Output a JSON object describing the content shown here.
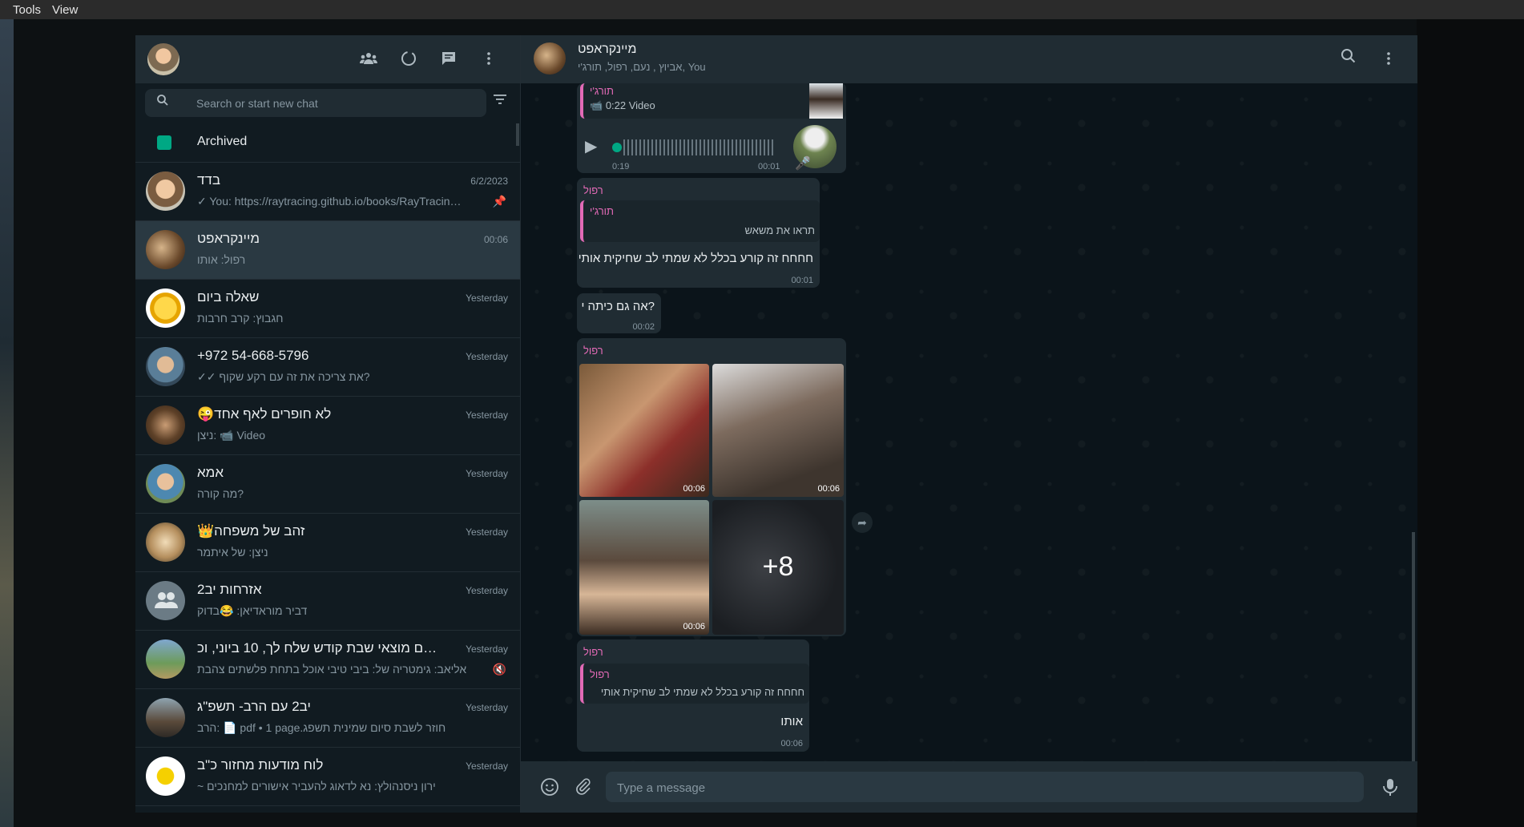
{
  "menubar": {
    "tools": "Tools",
    "view": "View"
  },
  "left": {
    "header_icons": [
      "communities-icon",
      "status-icon",
      "new-chat-icon",
      "menu-icon"
    ],
    "search_placeholder": "Search or start new chat",
    "archived_label": "Archived",
    "chats": [
      {
        "name": "בדד",
        "time": "6/2/2023",
        "preview": "✓ You: https://raytracing.github.io/books/RayTracingInO...",
        "pinned": true
      },
      {
        "name": "מיינקראפט",
        "time": "00:06",
        "preview": "רפול: אותו",
        "active": true
      },
      {
        "name": "שאלה ביום",
        "time": "Yesterday",
        "preview": "חגבוץ: קרב חרבות"
      },
      {
        "name": "+972 54-668-5796",
        "time": "Yesterday",
        "preview": "✓✓ את צריכה את זה עם רקע שקוף?"
      },
      {
        "name": "😜לא חופרים לאף אחד",
        "time": "Yesterday",
        "preview": "ניצן: 📹 Video"
      },
      {
        "name": "אמא",
        "time": "Yesterday",
        "preview": "מה קורה?"
      },
      {
        "name": "👑זהב של משפחה",
        "time": "Yesterday",
        "preview": "ניצן: של איתמר"
      },
      {
        "name": "אזרחות יב2",
        "time": "Yesterday",
        "preview": "דביר מוראדיאן: 😂בדוק"
      },
      {
        "name": "היום מוצאי שבת קודש שלח לך, 10 ביוני, וכ...",
        "time": "Yesterday",
        "preview": "אליאב: גימטריה של: ביבי טיבי אוכל בתחת פלשתים צהבת",
        "muted": true
      },
      {
        "name": "יב2 עם הרב- תשפ\"ג",
        "time": "Yesterday",
        "preview": "הרב: 📄 pdf • 1 page.חוזר לשבת סיום שמינית תשפג"
      },
      {
        "name": "לוח מודעות מחזור כ\"ב",
        "time": "Yesterday",
        "preview": "~ ירון ניסנהולץ: נא לדאוג להעביר אישורים למחנכים"
      }
    ]
  },
  "conversation": {
    "title": "מיינקראפט",
    "subtitle": "אביוץ , נעם, רפול, תורג'י, You",
    "messages": {
      "m1": {
        "quote_sender": "תורג'י",
        "quote_text": "0:22 Video",
        "voice_elapsed": "0:19",
        "time": "00:01"
      },
      "m2": {
        "sender": "רפול",
        "quote_sender": "תורג'י",
        "quote_text": "תראו את משאש",
        "text": "חחחח זה קורע בכלל לא שמתי לב שחיקית אותי",
        "time": "00:01"
      },
      "m3": {
        "text": "אה גם כיתה י?",
        "time": "00:02"
      },
      "m4": {
        "sender": "רפול",
        "photo_times": [
          "00:06",
          "00:06",
          "00:06"
        ],
        "more": "+8"
      },
      "m5": {
        "sender": "רפול",
        "quote_sender": "רפול",
        "quote_text": "חחחח זה קורע בכלל לא שמתי לב שחיקית אותי",
        "text": "אותו",
        "time": "00:06"
      }
    },
    "composer_placeholder": "Type a message"
  },
  "colors": {
    "accent": "#00a884",
    "sender": "#e26ab6",
    "panel": "#202c33",
    "bg": "#0b141a"
  }
}
